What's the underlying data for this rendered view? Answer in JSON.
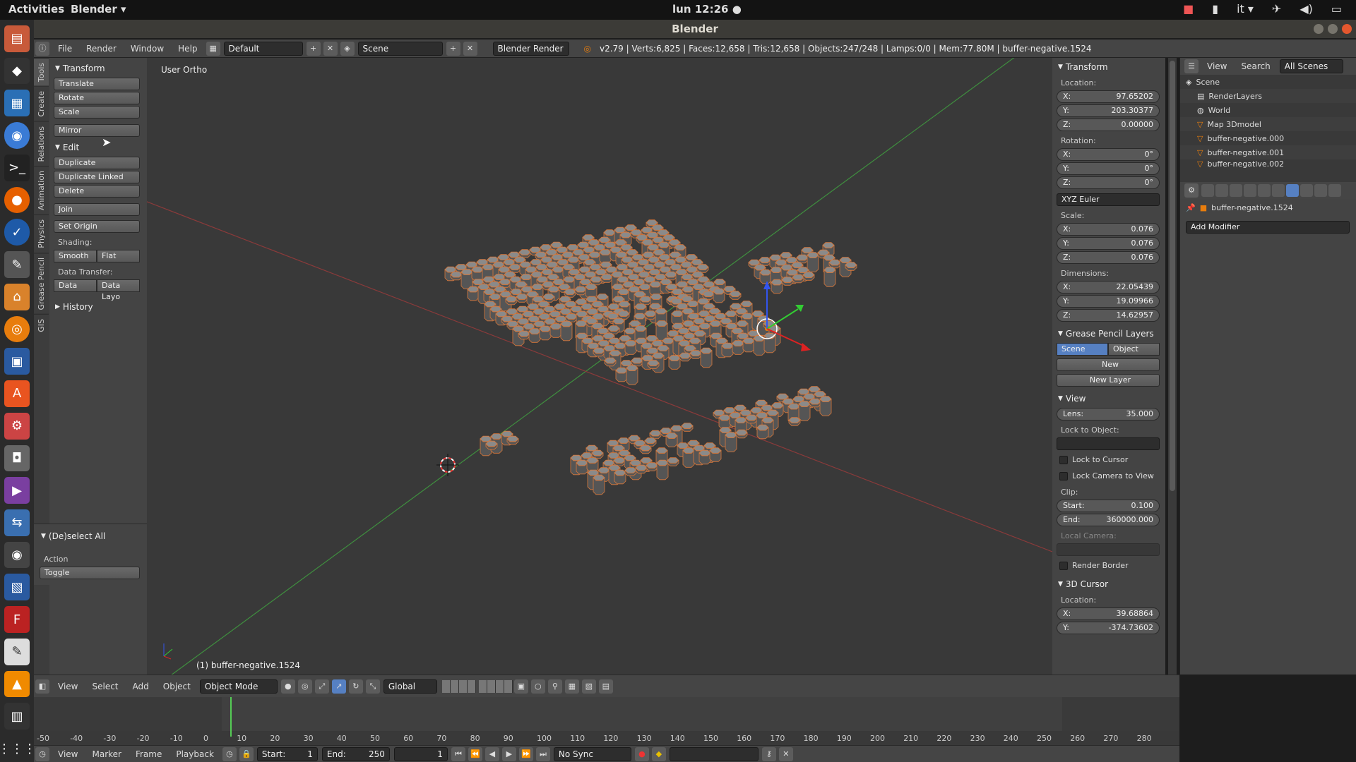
{
  "topbar": {
    "activities": "Activities",
    "app": "Blender ▾",
    "clock": "lun 12:26 ●",
    "lang": "it ▾"
  },
  "window": {
    "title": "Blender"
  },
  "infobar": {
    "menus": [
      "File",
      "Render",
      "Window",
      "Help"
    ],
    "layout": "Default",
    "scene": "Scene",
    "engine": "Blender Render",
    "stats": "v2.79 | Verts:6,825 | Faces:12,658 | Tris:12,658 | Objects:247/248 | Lamps:0/0 | Mem:77.80M | buffer-negative.1524"
  },
  "vtabs": [
    "Tools",
    "Create",
    "Relations",
    "Animation",
    "Physics",
    "Grease Pencil",
    "GIS"
  ],
  "toolshelf": {
    "transform_title": "Transform",
    "translate": "Translate",
    "rotate": "Rotate",
    "scale": "Scale",
    "mirror": "Mirror",
    "edit_title": "Edit",
    "duplicate": "Duplicate",
    "duplicate_linked": "Duplicate Linked",
    "delete": "Delete",
    "join": "Join",
    "set_origin": "Set Origin",
    "shading_label": "Shading:",
    "smooth": "Smooth",
    "flat": "Flat",
    "data_transfer_label": "Data Transfer:",
    "data": "Data",
    "data_layo": "Data Layo",
    "history_title": "History",
    "deselect_title": "(De)select All",
    "action_label": "Action",
    "action_value": "Toggle"
  },
  "viewport": {
    "view_name": "User Ortho",
    "object_label": "(1) buffer-negative.1524"
  },
  "vheader": {
    "view": "View",
    "select": "Select",
    "add": "Add",
    "object": "Object",
    "mode": "Object Mode",
    "orientation": "Global"
  },
  "npanel": {
    "transform_title": "Transform",
    "location_label": "Location:",
    "loc": [
      {
        "axis": "X:",
        "value": "97.65202"
      },
      {
        "axis": "Y:",
        "value": "203.30377"
      },
      {
        "axis": "Z:",
        "value": "0.00000"
      }
    ],
    "rotation_label": "Rotation:",
    "rot": [
      {
        "axis": "X:",
        "value": "0°"
      },
      {
        "axis": "Y:",
        "value": "0°"
      },
      {
        "axis": "Z:",
        "value": "0°"
      }
    ],
    "euler": "XYZ Euler",
    "scale_label": "Scale:",
    "scale": [
      {
        "axis": "X:",
        "value": "0.076"
      },
      {
        "axis": "Y:",
        "value": "0.076"
      },
      {
        "axis": "Z:",
        "value": "0.076"
      }
    ],
    "dimensions_label": "Dimensions:",
    "dim": [
      {
        "axis": "X:",
        "value": "22.05439"
      },
      {
        "axis": "Y:",
        "value": "19.09966"
      },
      {
        "axis": "Z:",
        "value": "14.62957"
      }
    ],
    "gp_title": "Grease Pencil Layers",
    "gp_scene": "Scene",
    "gp_object": "Object",
    "gp_new": "New",
    "gp_new_layer": "New Layer",
    "view_title": "View",
    "lens_label": "Lens:",
    "lens_value": "35.000",
    "lock_object_label": "Lock to Object:",
    "lock_cursor": "Lock to Cursor",
    "lock_camera": "Lock Camera to View",
    "clip_label": "Clip:",
    "clip_start_label": "Start:",
    "clip_start": "0.100",
    "clip_end_label": "End:",
    "clip_end": "360000.000",
    "local_camera_label": "Local Camera:",
    "render_border": "Render Border",
    "cursor_title": "3D Cursor",
    "cursor_location_label": "Location:",
    "cursor": [
      {
        "axis": "X:",
        "value": "39.68864"
      },
      {
        "axis": "Y:",
        "value": "-374.73602"
      }
    ]
  },
  "outliner": {
    "view": "View",
    "search": "Search",
    "all_scenes": "All Scenes",
    "rows": [
      "Scene",
      "RenderLayers",
      "World",
      "Map 3Dmodel",
      "buffer-negative.000",
      "buffer-negative.001",
      "buffer-negative.002"
    ]
  },
  "props": {
    "object_name": "buffer-negative.1524",
    "add_modifier": "Add Modifier"
  },
  "timeline": {
    "ticks": [
      "-50",
      "-40",
      "-30",
      "-20",
      "-10",
      "0",
      "10",
      "20",
      "30",
      "40",
      "50",
      "60",
      "70",
      "80",
      "90",
      "100",
      "110",
      "120",
      "130",
      "140",
      "150",
      "160",
      "170",
      "180",
      "190",
      "200",
      "210",
      "220",
      "230",
      "240",
      "250",
      "260",
      "270",
      "280"
    ],
    "current_frame": "1"
  },
  "tlheader": {
    "view": "View",
    "marker": "Marker",
    "frame": "Frame",
    "playback": "Playback",
    "start_label": "Start:",
    "start": "1",
    "end_label": "End:",
    "end": "250",
    "current": "1",
    "sync": "No Sync"
  }
}
